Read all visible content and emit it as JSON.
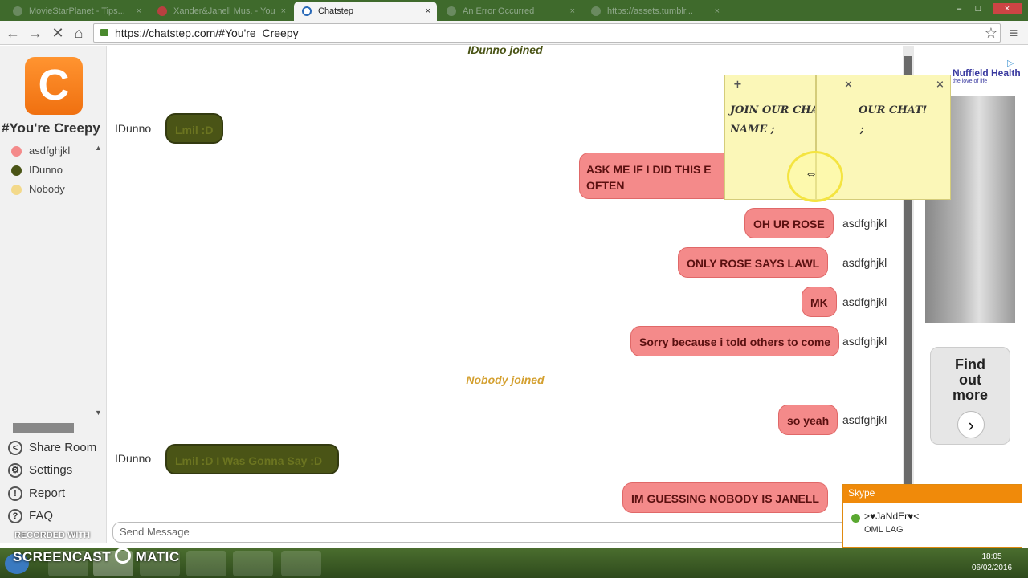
{
  "browser": {
    "tabs": [
      {
        "label": "MovieStarPlanet - Tips..."
      },
      {
        "label": "Xander&Janell Mus. - You"
      },
      {
        "label": "Chatstep"
      },
      {
        "label": "An Error Occurred"
      },
      {
        "label": "https://assets.tumblr..."
      }
    ],
    "url": "https://chatstep.com/#You're_Creepy"
  },
  "sidebar": {
    "logo_letter": "C",
    "room_name": "#You're Creepy",
    "users": [
      {
        "name": "asdfghjkl",
        "color": "#f48a8a"
      },
      {
        "name": "IDunno",
        "color": "#4a5416"
      },
      {
        "name": "Nobody",
        "color": "#f3d98a"
      }
    ],
    "menu": [
      {
        "label": "Share Room",
        "icon": "share-icon"
      },
      {
        "label": "Settings",
        "icon": "settings-icon"
      },
      {
        "label": "Report",
        "icon": "report-icon"
      },
      {
        "label": "FAQ",
        "icon": "faq-icon"
      }
    ]
  },
  "chat": {
    "system1": "IDunno joined",
    "system2": "Nobody joined",
    "messages": [
      {
        "user": "IDunno",
        "text": "Lmil :D"
      },
      {
        "user": "asdfghjkl",
        "text_line1": "ASK ME IF I DID THIS E",
        "text_line2": "OFTEN"
      },
      {
        "user": "asdfghjkl",
        "text": "OH UR ROSE"
      },
      {
        "user": "asdfghjkl",
        "text": "ONLY ROSE SAYS LAWL"
      },
      {
        "user": "asdfghjkl",
        "text": "MK"
      },
      {
        "user": "asdfghjkl",
        "text": "Sorry because i told others to come"
      },
      {
        "user": "asdfghjkl",
        "text": "so yeah"
      },
      {
        "user": "IDunno",
        "text": "Lmil :D I Was Gonna Say :D"
      },
      {
        "user": "asdfghjkl",
        "text": "IM GUESSING NOBODY IS JANELL"
      }
    ],
    "send_placeholder": "Send Message"
  },
  "ad": {
    "brand": "Nuffield Health",
    "tagline": "the love of life",
    "cta": "Find out more"
  },
  "notes": {
    "left": {
      "line1": "JOIN OUR CHAT!",
      "line2": "NAME ;"
    },
    "right": {
      "line1": "OUR CHAT!",
      "line2": ";"
    }
  },
  "skype": {
    "title": "Skype",
    "user": ">♥JaNdEr♥<",
    "message": "OML LAG"
  },
  "watermark": {
    "line1": "RECORDED WITH",
    "line2": "SCREENCAST",
    "line3": "MATIC"
  },
  "taskbar": {
    "time": "18:05",
    "date": "06/02/2016"
  }
}
